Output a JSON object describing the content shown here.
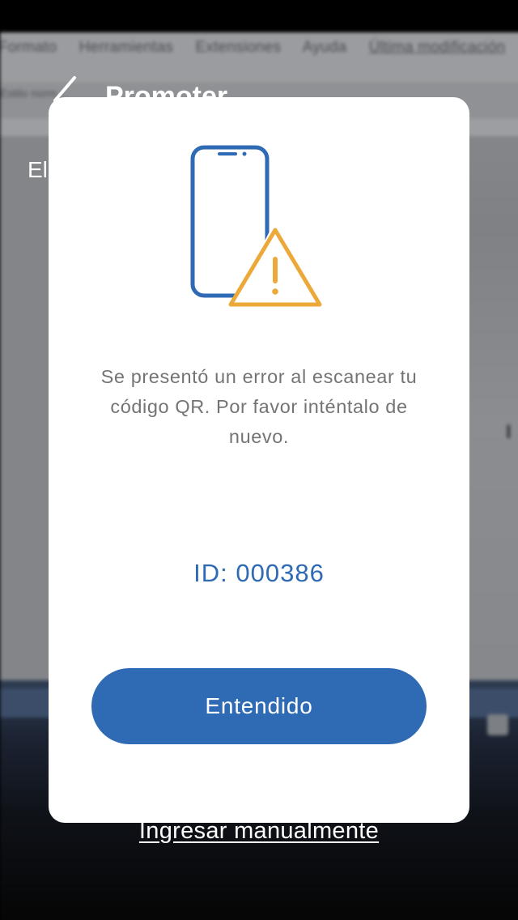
{
  "background": {
    "menu_items": [
      "Formato",
      "Herramientas",
      "Extensiones",
      "Ayuda",
      "Última modificación"
    ],
    "toolbar_text": "Estilo norm...",
    "screen_title": "Promoter",
    "screen_hint": "El au",
    "manual_link_label": "Ingresar manualmente"
  },
  "modal": {
    "illustration_icon": "phone-warning-icon",
    "message": "Se presentó un error al escanear tu código QR.  Por favor inténtalo de nuevo.",
    "id_text": "ID: 000386",
    "confirm_label": "Entendido"
  },
  "colors": {
    "accent": "#2f6ab4",
    "warning": "#eca93a",
    "message_text": "#747474",
    "modal_bg": "#ffffff"
  }
}
